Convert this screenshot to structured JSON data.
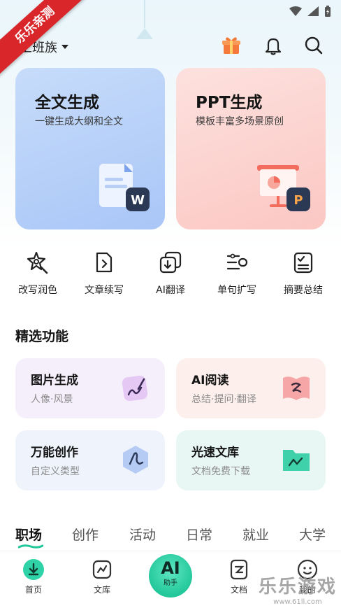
{
  "watermark": {
    "ribbon": "乐乐亲测",
    "site_name": "乐乐游戏",
    "site_url": "www.61ll.com"
  },
  "header": {
    "title": "上班族"
  },
  "hero_cards": [
    {
      "title": "全文生成",
      "subtitle": "一键生成大纲和全文",
      "badge": "W"
    },
    {
      "title": "PPT生成",
      "subtitle": "模板丰富多场景原创",
      "badge": "P"
    }
  ],
  "tools": [
    {
      "label": "改写润色",
      "icon": "star-pen-icon"
    },
    {
      "label": "文章续写",
      "icon": "document-arrow-icon"
    },
    {
      "label": "AI翻译",
      "icon": "translate-icon"
    },
    {
      "label": "单句扩写",
      "icon": "expand-lines-icon"
    },
    {
      "label": "摘要总结",
      "icon": "checklist-icon"
    }
  ],
  "featured": {
    "title": "精选功能",
    "cards": [
      {
        "title": "图片生成",
        "subtitle": "人像·风景"
      },
      {
        "title": "AI阅读",
        "subtitle": "总结·提问·翻译"
      },
      {
        "title": "万能创作",
        "subtitle": "自定义类型"
      },
      {
        "title": "光速文库",
        "subtitle": "文档免费下载"
      }
    ]
  },
  "categories": [
    "职场",
    "创作",
    "活动",
    "日常",
    "就业",
    "大学"
  ],
  "active_category": "职场",
  "bottom_nav": {
    "home": "首页",
    "library": "文库",
    "ai_big": "AI",
    "ai_small": "助手",
    "docs": "文档",
    "mine": "我的"
  },
  "colors": {
    "accent": "#22c79a",
    "hero_left": "#b4cff8",
    "hero_right": "#fcd3cf"
  }
}
